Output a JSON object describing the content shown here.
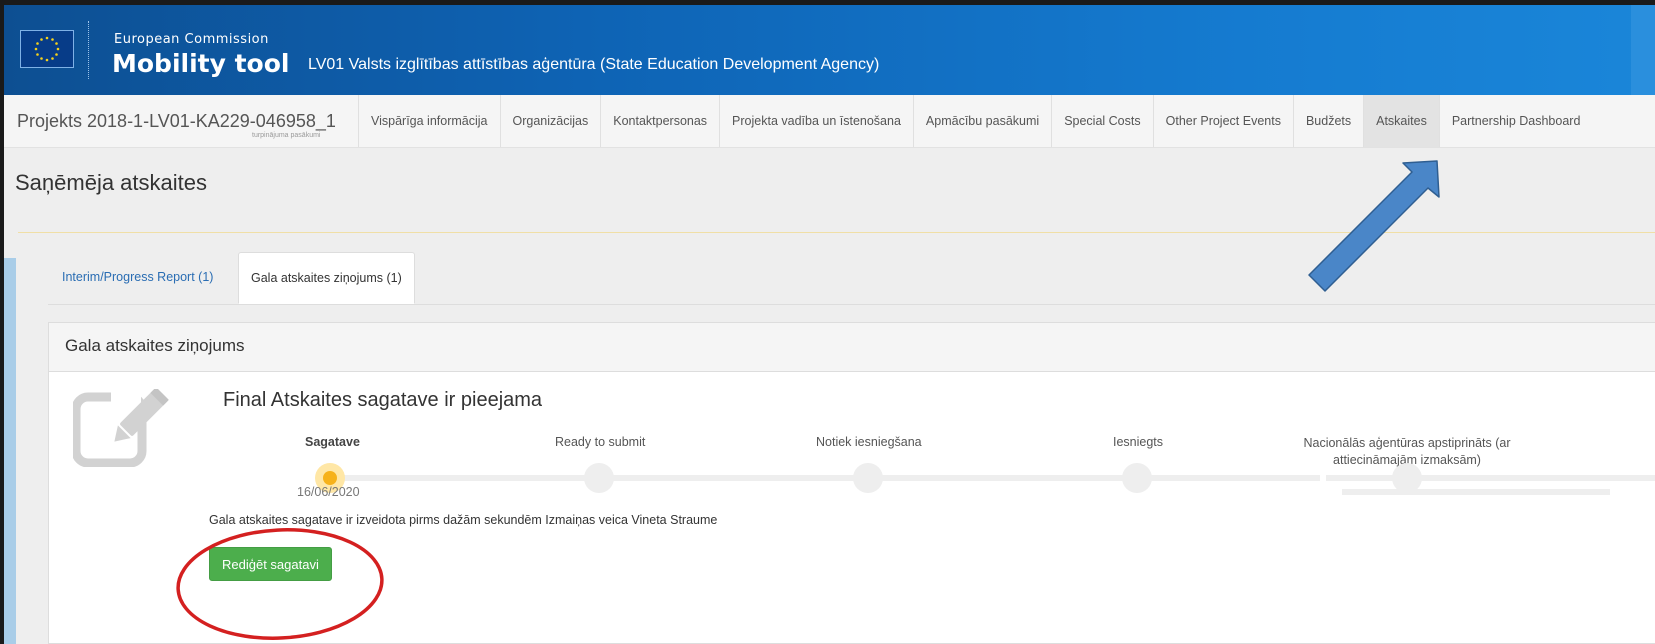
{
  "header": {
    "org": "European Commission",
    "tool": "Mobility tool",
    "agency": "LV01 Valsts izglītības attīstības aģentūra (State Education Development Agency)"
  },
  "nav": {
    "project": "Projekts 2018-1-LV01-KA229-046958_1",
    "project_sub": "turpinājuma pasākumi",
    "tabs": [
      "Vispārīga informācija",
      "Organizācijas",
      "Kontaktpersonas",
      "Projekta vadība un īstenošana",
      "Apmācību pasākumi",
      "Special Costs",
      "Other Project Events",
      "Budžets",
      "Atskaites",
      "Partnership Dashboard"
    ],
    "active_tab": "Atskaites"
  },
  "page": {
    "title": "Saņēmēja atskaites",
    "subtabs": [
      "Interim/Progress Report (1)",
      "Gala atskaites ziņojums (1)"
    ],
    "active_subtab": "Gala atskaites ziņojums (1)"
  },
  "panel": {
    "title": "Gala atskaites ziņojums",
    "status": "Final Atskaites sagatave ir pieejama",
    "steps": [
      "Sagatave",
      "Ready to submit",
      "Notiek iesniegšana",
      "Iesniegts",
      "Nacionālās aģentūras apstiprināts (ar attiecināmajām izmaksām)"
    ],
    "current_step": 0,
    "date": "16/06/2020",
    "info": "Gala atskaites sagatave ir izveidota pirms dažām sekundēm Izmaiņas veica Vineta Straume",
    "button": "Rediģēt sagatavi"
  },
  "colors": {
    "header_blue": "#0e63b4",
    "button_green": "#4cae4c",
    "current_step": "#f6b21b",
    "annotation_arrow": "#4a86c8",
    "annotation_circle": "#d42020"
  },
  "icons": [
    "eu-flag-icon",
    "edit-document-icon"
  ]
}
